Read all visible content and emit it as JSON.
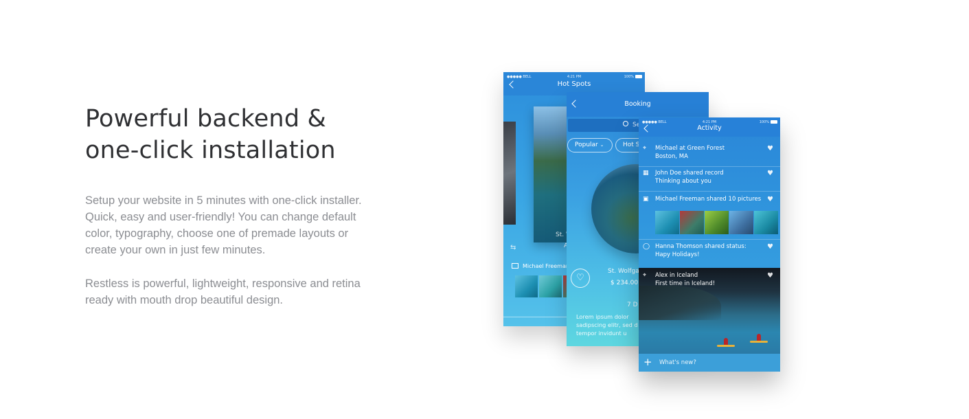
{
  "section": {
    "heading_line1": "Powerful backend &",
    "heading_line2": "one-click installation",
    "paragraph1_l1": "Setup your website in 5 minutes with one-click installer.",
    "paragraph1_l2": "Quick, easy and user-friendly! You can change default",
    "paragraph1_l3": "color, typography, choose one of premade layouts or",
    "paragraph1_l4": "create your own in just few minutes.",
    "paragraph2_l1": "Restless is powerful, lightweight, responsive and retina",
    "paragraph2_l2": "ready with mouth drop beautiful design."
  },
  "status_bar": {
    "carrier": "●●●●● BELL",
    "time": "4:21 PM",
    "battery": "100%"
  },
  "phone_hotspots": {
    "title": "Hot Spots",
    "card_name": "St. W",
    "card_sub": "A",
    "feed_text": "Michael Freeman"
  },
  "phone_booking": {
    "title": "Booking",
    "search_text": "Se",
    "filter_popular": "Popular",
    "filter_hotspots": "Hot S",
    "place": "St. Wolfga",
    "price": "$ 234.00",
    "days": "7 D",
    "lorem_l1": "Lorem ipsum dolor",
    "lorem_l2": "sadipscing elitr, sed d",
    "lorem_l3": "tempor invidunt u"
  },
  "phone_activity": {
    "title": "Activity",
    "items": [
      {
        "line1": "Michael at Green Forest",
        "line2": "Boston, MA",
        "icon": "pin-icon"
      },
      {
        "line1": "John Doe shared record",
        "line2": "Thinking about you",
        "icon": "calendar-icon"
      },
      {
        "line1": "Michael Freeman shared 10 pictures",
        "line2": "",
        "icon": "image-icon"
      },
      {
        "line1": "Hanna Thomson shared status:",
        "line2": "Hapy Holidays!",
        "icon": "chat-icon"
      }
    ],
    "hero_line1": "Alex in Iceland",
    "hero_line2": "First time in Iceland!",
    "compose_placeholder": "What's new?"
  }
}
